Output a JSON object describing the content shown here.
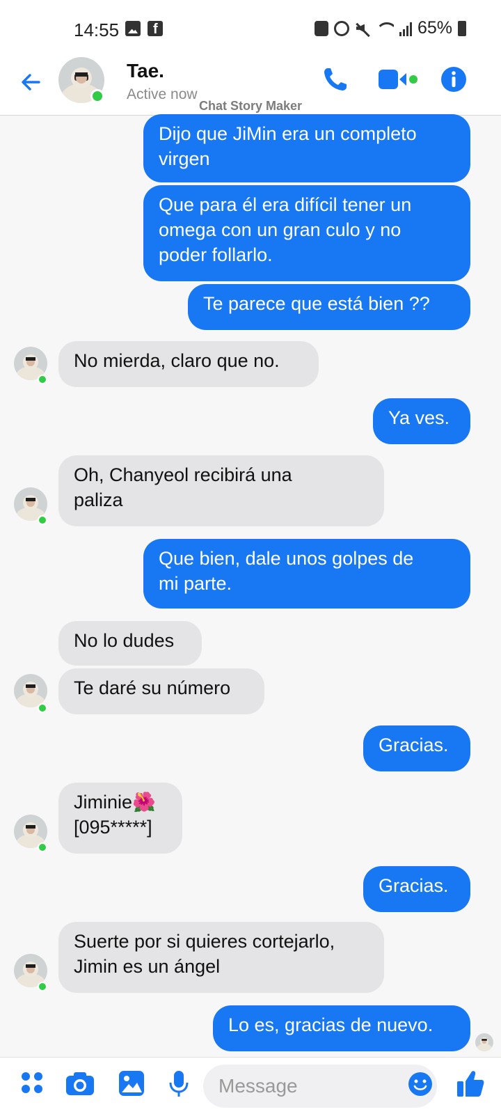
{
  "status_bar": {
    "time": "14:55",
    "battery": "65%",
    "icons": [
      "gallery-icon",
      "facebook-icon",
      "battery-saver-icon",
      "alarm-icon",
      "mute-icon",
      "wifi-icon",
      "signal-icon",
      "battery-icon"
    ]
  },
  "header": {
    "name": "Tae.",
    "status": "Active now",
    "watermark": "Chat Story Maker"
  },
  "colors": {
    "accent": "#1877f2",
    "incoming_bubble": "#e4e4e6",
    "online": "#31cc46"
  },
  "messages": [
    {
      "side": "out",
      "lines": [
        "Dijo que JiMin era un completo",
        "virgen"
      ]
    },
    {
      "side": "out",
      "lines": [
        "Que para él era difícil tener un",
        "omega con un gran culo y no",
        "poder follarlo."
      ]
    },
    {
      "side": "out",
      "lines": [
        "Te parece que está bien ??"
      ]
    },
    {
      "side": "in",
      "lines": [
        "No mierda, claro que no."
      ]
    },
    {
      "side": "out",
      "lines": [
        "Ya ves."
      ]
    },
    {
      "side": "in",
      "lines": [
        "Oh, Chanyeol recibirá una",
        "paliza"
      ]
    },
    {
      "side": "out",
      "lines": [
        "Que bien, dale unos golpes de",
        "mi parte."
      ]
    },
    {
      "side": "in",
      "lines": [
        "No lo dudes"
      ]
    },
    {
      "side": "in",
      "lines": [
        "Te daré su número"
      ]
    },
    {
      "side": "out",
      "lines": [
        "Gracias."
      ]
    },
    {
      "side": "in",
      "lines": [
        "Jiminie🌺",
        "[095*****]"
      ]
    },
    {
      "side": "out",
      "lines": [
        "Gracias."
      ]
    },
    {
      "side": "in",
      "lines": [
        "Suerte por si quieres cortejarlo,",
        "Jimin es un ángel"
      ]
    },
    {
      "side": "out",
      "lines": [
        "Lo es, gracias de nuevo."
      ]
    }
  ],
  "composer": {
    "placeholder": "Message"
  }
}
